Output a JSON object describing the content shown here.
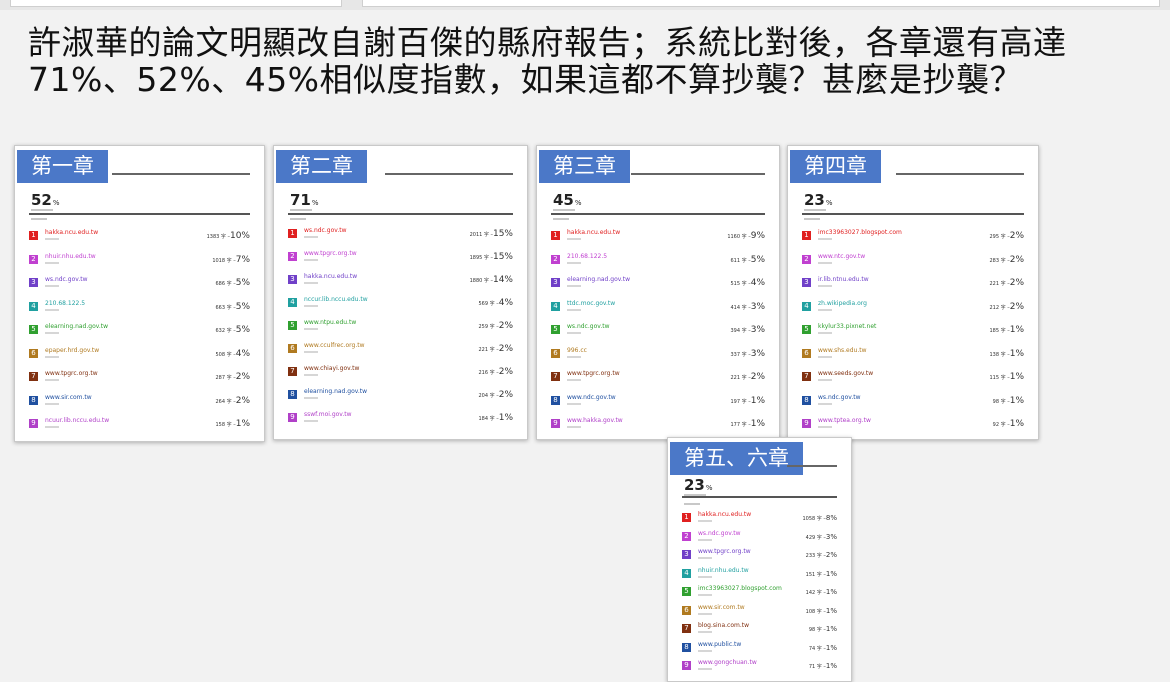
{
  "headline": "許淑華的論文明顯改自謝百傑的縣府報告；系統比對後，各章還有高達71%、52%、45%相似度指數，如果這都不算抄襲？甚麼是抄襲？",
  "cards": [
    {
      "chapter": "第一章",
      "percent": "52",
      "sources": [
        {
          "n": "1",
          "color": "#e02020",
          "source": "hakka.ncu.edu.tw",
          "count": "1383 字 –",
          "pct": "10%"
        },
        {
          "n": "2",
          "color": "#c040d0",
          "source": "nhuir.nhu.edu.tw",
          "count": "1018 字 –",
          "pct": "7%"
        },
        {
          "n": "3",
          "color": "#7040c8",
          "source": "ws.ndc.gov.tw",
          "count": "686 字 –",
          "pct": "5%"
        },
        {
          "n": "4",
          "color": "#20a0a0",
          "source": "210.68.122.5",
          "count": "663 字 –",
          "pct": "5%"
        },
        {
          "n": "5",
          "color": "#30a030",
          "source": "elearning.nad.gov.tw",
          "count": "632 字 –",
          "pct": "5%"
        },
        {
          "n": "6",
          "color": "#b07a20",
          "source": "epaper.hrd.gov.tw",
          "count": "508 字 –",
          "pct": "4%"
        },
        {
          "n": "7",
          "color": "#803010",
          "source": "www.tpgrc.org.tw",
          "count": "287 字 –",
          "pct": "2%"
        },
        {
          "n": "8",
          "color": "#2050a0",
          "source": "www.sir.com.tw",
          "count": "264 字 –",
          "pct": "2%"
        },
        {
          "n": "9",
          "color": "#b040c8",
          "source": "ncuur.lib.nccu.edu.tw",
          "count": "158 字 –",
          "pct": "1%"
        }
      ]
    },
    {
      "chapter": "第二章",
      "percent": "71",
      "sources": [
        {
          "n": "1",
          "color": "#e02020",
          "source": "ws.ndc.gov.tw",
          "count": "2011 字 –",
          "pct": "15%"
        },
        {
          "n": "2",
          "color": "#c040d0",
          "source": "www.tpgrc.org.tw",
          "count": "1895 字 –",
          "pct": "15%"
        },
        {
          "n": "3",
          "color": "#7040c8",
          "source": "hakka.ncu.edu.tw",
          "count": "1880 字 –",
          "pct": "14%"
        },
        {
          "n": "4",
          "color": "#20a0a0",
          "source": "nccur.lib.nccu.edu.tw",
          "count": "569 字 –",
          "pct": "4%"
        },
        {
          "n": "5",
          "color": "#30a030",
          "source": "www.ntpu.edu.tw",
          "count": "259 字 –",
          "pct": "2%"
        },
        {
          "n": "6",
          "color": "#b07a20",
          "source": "www.cculfrec.org.tw",
          "count": "221 字 –",
          "pct": "2%"
        },
        {
          "n": "7",
          "color": "#803010",
          "source": "www.chiayi.gov.tw",
          "count": "216 字 –",
          "pct": "2%"
        },
        {
          "n": "8",
          "color": "#2050a0",
          "source": "elearning.nad.gov.tw",
          "count": "204 字 –",
          "pct": "2%"
        },
        {
          "n": "9",
          "color": "#b040c8",
          "source": "sswf.moi.gov.tw",
          "count": "184 字 –",
          "pct": "1%"
        }
      ]
    },
    {
      "chapter": "第三章",
      "percent": "45",
      "sources": [
        {
          "n": "1",
          "color": "#e02020",
          "source": "hakka.ncu.edu.tw",
          "count": "1160 字 –",
          "pct": "9%"
        },
        {
          "n": "2",
          "color": "#c040d0",
          "source": "210.68.122.5",
          "count": "611 字 –",
          "pct": "5%"
        },
        {
          "n": "3",
          "color": "#7040c8",
          "source": "elearning.nad.gov.tw",
          "count": "515 字 –",
          "pct": "4%"
        },
        {
          "n": "4",
          "color": "#20a0a0",
          "source": "ttdc.moc.gov.tw",
          "count": "414 字 –",
          "pct": "3%"
        },
        {
          "n": "5",
          "color": "#30a030",
          "source": "ws.ndc.gov.tw",
          "count": "394 字 –",
          "pct": "3%"
        },
        {
          "n": "6",
          "color": "#b07a20",
          "source": "996.cc",
          "count": "337 字 –",
          "pct": "3%"
        },
        {
          "n": "7",
          "color": "#803010",
          "source": "www.tpgrc.org.tw",
          "count": "221 字 –",
          "pct": "2%"
        },
        {
          "n": "8",
          "color": "#2050a0",
          "source": "www.ndc.gov.tw",
          "count": "197 字 –",
          "pct": "1%"
        },
        {
          "n": "9",
          "color": "#b040c8",
          "source": "www.hakka.gov.tw",
          "count": "177 字 –",
          "pct": "1%"
        }
      ]
    },
    {
      "chapter": "第四章",
      "percent": "23",
      "sources": [
        {
          "n": "1",
          "color": "#e02020",
          "source": "imc33963027.blogspot.com",
          "count": "295 字 –",
          "pct": "2%"
        },
        {
          "n": "2",
          "color": "#c040d0",
          "source": "www.ntc.gov.tw",
          "count": "283 字 –",
          "pct": "2%"
        },
        {
          "n": "3",
          "color": "#7040c8",
          "source": "ir.lib.ntnu.edu.tw",
          "count": "221 字 –",
          "pct": "2%"
        },
        {
          "n": "4",
          "color": "#20a0a0",
          "source": "zh.wikipedia.org",
          "count": "212 字 –",
          "pct": "2%"
        },
        {
          "n": "5",
          "color": "#30a030",
          "source": "kkylur33.pixnet.net",
          "count": "185 字 –",
          "pct": "1%"
        },
        {
          "n": "6",
          "color": "#b07a20",
          "source": "www.shs.edu.tw",
          "count": "138 字 –",
          "pct": "1%"
        },
        {
          "n": "7",
          "color": "#803010",
          "source": "www.seeds.gov.tw",
          "count": "115 字 –",
          "pct": "1%"
        },
        {
          "n": "8",
          "color": "#2050a0",
          "source": "ws.ndc.gov.tw",
          "count": "98 字 –",
          "pct": "1%"
        },
        {
          "n": "9",
          "color": "#b040c8",
          "source": "www.tptea.org.tw",
          "count": "92 字 –",
          "pct": "1%"
        }
      ]
    },
    {
      "chapter": "第五、六章",
      "percent": "23",
      "sources": [
        {
          "n": "1",
          "color": "#e02020",
          "source": "hakka.ncu.edu.tw",
          "count": "1058 字 –",
          "pct": "8%"
        },
        {
          "n": "2",
          "color": "#c040d0",
          "source": "ws.ndc.gov.tw",
          "count": "429 字 –",
          "pct": "3%"
        },
        {
          "n": "3",
          "color": "#7040c8",
          "source": "www.tpgrc.org.tw",
          "count": "233 字 –",
          "pct": "2%"
        },
        {
          "n": "4",
          "color": "#20a0a0",
          "source": "nhuir.nhu.edu.tw",
          "count": "151 字 –",
          "pct": "1%"
        },
        {
          "n": "5",
          "color": "#30a030",
          "source": "imc33963027.blogspot.com",
          "count": "142 字 –",
          "pct": "1%"
        },
        {
          "n": "6",
          "color": "#b07a20",
          "source": "www.sir.com.tw",
          "count": "108 字 –",
          "pct": "1%"
        },
        {
          "n": "7",
          "color": "#803010",
          "source": "blog.sina.com.tw",
          "count": "98 字 –",
          "pct": "1%"
        },
        {
          "n": "8",
          "color": "#2050a0",
          "source": "www.public.tw",
          "count": "74 字 –",
          "pct": "1%"
        },
        {
          "n": "9",
          "color": "#b040c8",
          "source": "www.gongchuan.tw",
          "count": "71 字 –",
          "pct": "1%"
        }
      ]
    }
  ]
}
